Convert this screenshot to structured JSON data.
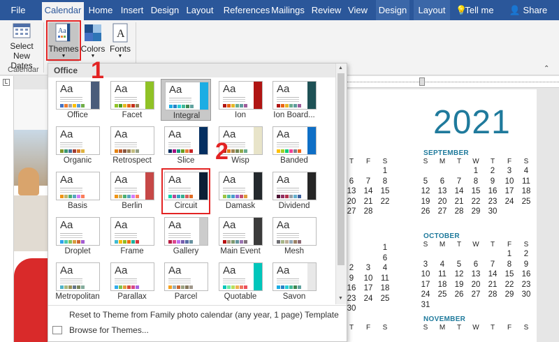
{
  "ribbon_tabs": [
    "File",
    "Calendar",
    "Home",
    "Insert",
    "Design",
    "Layout",
    "References",
    "Mailings",
    "Review",
    "View",
    "Design",
    "Layout"
  ],
  "tell_me": "Tell me",
  "share": "Share",
  "ribbon": {
    "select_new_dates_1": "Select",
    "select_new_dates_2": "New Dates",
    "themes": "Themes",
    "colors": "Colors",
    "fonts": "Fonts",
    "group_calendar": "Calendar"
  },
  "gallery": {
    "header": "Office",
    "themes": [
      {
        "name": "Office",
        "accent": "#4a5c7a",
        "sw": [
          "#4472c4",
          "#ed7d31",
          "#a5a5a5",
          "#ffc000",
          "#5b9bd5",
          "#70ad47"
        ]
      },
      {
        "name": "Facet",
        "accent": "#90c226",
        "sw": [
          "#90c226",
          "#54a021",
          "#e6b91e",
          "#e76618",
          "#c42f1a",
          "#918655"
        ]
      },
      {
        "name": "Integral",
        "accent": "#1cade4",
        "sw": [
          "#1cade4",
          "#2683c6",
          "#27ced7",
          "#42ba97",
          "#3e8853",
          "#62a39f"
        ]
      },
      {
        "name": "Ion",
        "accent": "#b01513",
        "sw": [
          "#b01513",
          "#ea6312",
          "#e6b729",
          "#6aac90",
          "#5f9c9d",
          "#9e5e9b"
        ]
      },
      {
        "name": "Ion Board...",
        "accent": "#1e5155",
        "sw": [
          "#b01513",
          "#ea6312",
          "#e6b729",
          "#6aac90",
          "#5f9c9d",
          "#9e5e9b"
        ]
      },
      {
        "name": "Organic",
        "accent": "#ffffff",
        "sw": [
          "#83992a",
          "#3c9770",
          "#44709d",
          "#a23c33",
          "#d97828",
          "#deb340"
        ]
      },
      {
        "name": "Retrospect",
        "accent": "#ffffff",
        "sw": [
          "#e48312",
          "#bd582c",
          "#865640",
          "#9b8357",
          "#c2bc80",
          "#94a088"
        ]
      },
      {
        "name": "Slice",
        "accent": "#052f61",
        "sw": [
          "#052f61",
          "#a50e82",
          "#14967c",
          "#6a9e1f",
          "#e87d37",
          "#c62324"
        ]
      },
      {
        "name": "Wisp",
        "accent": "#e8e4c9",
        "sw": [
          "#a53010",
          "#de7e18",
          "#9f8351",
          "#728653",
          "#92aa4c",
          "#6aac91"
        ]
      },
      {
        "name": "Banded",
        "accent": "#0f6fc6",
        "sw": [
          "#ffc000",
          "#a5d028",
          "#08cc78",
          "#f24099",
          "#828288",
          "#f56617"
        ]
      },
      {
        "name": "Basis",
        "accent": "#ffffff",
        "sw": [
          "#f09415",
          "#c1b56b",
          "#4baf73",
          "#5aa6c0",
          "#d17df9",
          "#fa7e5c"
        ]
      },
      {
        "name": "Berlin",
        "accent": "#c64847",
        "sw": [
          "#f09415",
          "#c1b56b",
          "#4baf73",
          "#5aa6c0",
          "#d17df9",
          "#fa7e5c"
        ]
      },
      {
        "name": "Circuit",
        "accent": "#0c1f35",
        "sw": [
          "#03d4a8",
          "#b14c96",
          "#36a1c4",
          "#38ad90",
          "#d65e5e",
          "#e06b23"
        ]
      },
      {
        "name": "Damask",
        "accent": "#24292d",
        "sw": [
          "#9ec544",
          "#50bea3",
          "#4a9ccc",
          "#9a66ca",
          "#c54f71",
          "#de9c3c"
        ]
      },
      {
        "name": "Dividend",
        "accent": "#262626",
        "sw": [
          "#4d1434",
          "#903163",
          "#b2324b",
          "#969fa7",
          "#66b1ce",
          "#40619d"
        ]
      },
      {
        "name": "Droplet",
        "accent": "#ffffff",
        "sw": [
          "#2fa3ee",
          "#4bcaad",
          "#86c157",
          "#d99c3f",
          "#ce6633",
          "#a35dd1"
        ]
      },
      {
        "name": "Frame",
        "accent": "#ffffff",
        "sw": [
          "#40bad2",
          "#fab900",
          "#90bb23",
          "#ee7008",
          "#1ab39f",
          "#d5393d"
        ]
      },
      {
        "name": "Gallery",
        "accent": "#cccccc",
        "sw": [
          "#b71e42",
          "#de478e",
          "#bc72f0",
          "#795faf",
          "#586ea6",
          "#6892a0"
        ]
      },
      {
        "name": "Main Event",
        "accent": "#3b3b3b",
        "sw": [
          "#b80e0f",
          "#a6987d",
          "#7f9a71",
          "#64969f",
          "#9b75b2",
          "#80737a"
        ]
      },
      {
        "name": "Mesh",
        "accent": "#ffffff",
        "sw": [
          "#6f6f74",
          "#a7b789",
          "#beae98",
          "#92a9b9",
          "#9c8265",
          "#8d6974"
        ]
      },
      {
        "name": "Metropolitan",
        "accent": "#ffffff",
        "sw": [
          "#50b4c8",
          "#a8b97f",
          "#9b9256",
          "#657689",
          "#7a855d",
          "#84ac9d"
        ]
      },
      {
        "name": "Parallax",
        "accent": "#ffffff",
        "sw": [
          "#30acec",
          "#80c34f",
          "#e29d3e",
          "#d64a3b",
          "#d64787",
          "#a666e1"
        ]
      },
      {
        "name": "Parcel",
        "accent": "#ffffff",
        "sw": [
          "#f6a21d",
          "#9bafb5",
          "#c96731",
          "#9ca383",
          "#87795d",
          "#a0988c"
        ]
      },
      {
        "name": "Quotable",
        "accent": "#00c6bb",
        "sw": [
          "#00c6bb",
          "#6feba0",
          "#b6df5e",
          "#efb251",
          "#ef755f",
          "#ed515c"
        ]
      },
      {
        "name": "Savon",
        "accent": "#e8e8e8",
        "sw": [
          "#1cade4",
          "#2683c6",
          "#27ced7",
          "#42ba97",
          "#3e8853",
          "#62a39f"
        ]
      }
    ],
    "footer_reset": "Reset to Theme from Family photo calendar (any year, 1 page) Template",
    "footer_browse": "Browse for Themes..."
  },
  "calendar": {
    "year": "2021",
    "september": {
      "name": "SEPTEMBER",
      "days_header": [
        "S",
        "M",
        "T",
        "W",
        "T",
        "F",
        "S"
      ],
      "rows": [
        [
          "",
          "",
          "",
          "1",
          "2",
          "3",
          "4"
        ],
        [
          "5",
          "6",
          "7",
          "8",
          "9",
          "10",
          "11"
        ],
        [
          "12",
          "13",
          "14",
          "15",
          "16",
          "17",
          "18"
        ],
        [
          "19",
          "20",
          "21",
          "22",
          "23",
          "24",
          "25"
        ],
        [
          "26",
          "27",
          "28",
          "29",
          "30",
          "",
          ""
        ]
      ]
    },
    "october": {
      "name": "OCTOBER",
      "days_header": [
        "S",
        "M",
        "T",
        "W",
        "T",
        "F",
        "S"
      ],
      "rows": [
        [
          "",
          "",
          "",
          "",
          "",
          "1",
          "2"
        ],
        [
          "3",
          "4",
          "5",
          "6",
          "7",
          "8",
          "9"
        ],
        [
          "10",
          "11",
          "12",
          "13",
          "14",
          "15",
          "16"
        ],
        [
          "17",
          "18",
          "19",
          "20",
          "21",
          "22",
          "23"
        ],
        [
          "24",
          "25",
          "26",
          "27",
          "28",
          "29",
          "30"
        ],
        [
          "31",
          "",
          "",
          "",
          "",
          "",
          ""
        ]
      ]
    },
    "november": {
      "name": "NOVEMBER",
      "days_header": [
        "S",
        "M",
        "T",
        "W",
        "T",
        "F",
        "S"
      ]
    },
    "left_col_header": [
      "T",
      "F",
      "S"
    ],
    "left_col_rows": [
      [
        "",
        "",
        "1"
      ],
      [
        "6",
        "7",
        "8"
      ],
      [
        "13",
        "14",
        "15"
      ],
      [
        "20",
        "21",
        "22"
      ],
      [
        "27",
        "28",
        ""
      ]
    ],
    "left_col_oct_rows": [
      [
        "",
        "",
        "1"
      ],
      [
        "",
        "",
        "6"
      ],
      [
        "2",
        "3",
        "4"
      ],
      [
        "9",
        "10",
        "11"
      ],
      [
        "16",
        "17",
        "18"
      ],
      [
        "23",
        "24",
        "25"
      ],
      [
        "30",
        "",
        ""
      ]
    ],
    "left_nov_header": [
      "T",
      "F",
      "S"
    ]
  },
  "annotations": {
    "one": "1",
    "two": "2"
  }
}
